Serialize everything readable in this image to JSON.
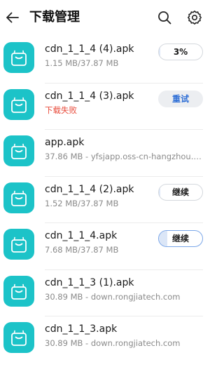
{
  "header": {
    "title": "下载管理",
    "back_icon": "arrow-left-icon",
    "search_icon": "search-icon",
    "settings_icon": "gear-icon"
  },
  "colors": {
    "accent": "#1cc3c8",
    "error": "#e84a3a",
    "action_blue": "#2f6fd6"
  },
  "downloads": [
    {
      "name": "cdn_1_1_4 (4).apk",
      "subtitle": "1.15 MB/37.87 MB",
      "status": "normal",
      "action": "3%",
      "action_style": "progress",
      "progress": 0.03
    },
    {
      "name": "cdn_1_1_4 (3).apk",
      "subtitle": "下载失败",
      "status": "error",
      "action": "重试",
      "action_style": "filled"
    },
    {
      "name": "app.apk",
      "subtitle": "37.86 MB - yfsjapp.oss-cn-hangzhou.a...",
      "status": "normal",
      "action": "",
      "action_style": "none"
    },
    {
      "name": "cdn_1_1_4 (2).apk",
      "subtitle": "1.52 MB/37.87 MB",
      "status": "normal",
      "action": "继续",
      "action_style": "progress",
      "progress": 0.04
    },
    {
      "name": "cdn_1_1_4.apk",
      "subtitle": "7.68 MB/37.87 MB",
      "status": "normal",
      "action": "继续",
      "action_style": "progress-blue",
      "progress": 0.2
    },
    {
      "name": "cdn_1_1_3 (1).apk",
      "subtitle": "30.89 MB - down.rongjiatech.com",
      "status": "normal",
      "action": "",
      "action_style": "none"
    },
    {
      "name": "cdn_1_1_3.apk",
      "subtitle": "30.89 MB - down.rongjiatech.com",
      "status": "normal",
      "action": "",
      "action_style": "none"
    }
  ]
}
